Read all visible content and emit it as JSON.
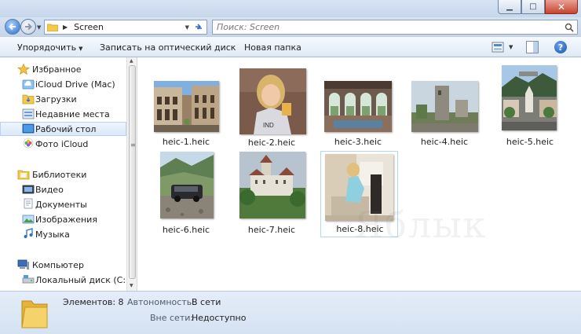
{
  "window": {
    "minimize_glyph": "▁",
    "maximize_glyph": "□",
    "close_glyph": "✕"
  },
  "address": {
    "path": "Screen",
    "search_placeholder": "Поиск: Screen"
  },
  "toolbar": {
    "organize_label": "Упорядочить",
    "burn_label": "Записать на оптический диск",
    "new_folder_label": "Новая папка",
    "help_label": "?"
  },
  "nav": {
    "favorites": {
      "label": "Избранное",
      "items": [
        {
          "label": "iCloud Drive (Mac)",
          "icon": "icloud-drive-icon"
        },
        {
          "label": "Загрузки",
          "icon": "downloads-folder-icon"
        },
        {
          "label": "Недавние места",
          "icon": "recent-places-icon"
        },
        {
          "label": "Рабочий стол",
          "icon": "desktop-icon"
        },
        {
          "label": "Фото iCloud",
          "icon": "icloud-photos-icon"
        }
      ]
    },
    "libraries": {
      "label": "Библиотеки",
      "items": [
        {
          "label": "Видео",
          "icon": "video-library-icon"
        },
        {
          "label": "Документы",
          "icon": "documents-library-icon"
        },
        {
          "label": "Изображения",
          "icon": "pictures-library-icon"
        },
        {
          "label": "Музыка",
          "icon": "music-library-icon"
        }
      ]
    },
    "computer": {
      "label": "Компьютер",
      "items": [
        {
          "label": "Локальный диск (C:)",
          "icon": "local-disk-icon"
        }
      ]
    }
  },
  "files": [
    {
      "name": "heic-1.heic",
      "selected": false
    },
    {
      "name": "heic-2.heic",
      "selected": false
    },
    {
      "name": "heic-3.heic",
      "selected": false
    },
    {
      "name": "heic-4.heic",
      "selected": false
    },
    {
      "name": "heic-5.heic",
      "selected": false
    },
    {
      "name": "heic-6.heic",
      "selected": false
    },
    {
      "name": "heic-7.heic",
      "selected": false
    },
    {
      "name": "heic-8.heic",
      "selected": true
    }
  ],
  "status": {
    "items_label": "Элементов: 8",
    "autonomy_key": "Автономность:",
    "autonomy_value": "В сети",
    "offline_key": "Вне сети:",
    "offline_value": "Недоступно"
  },
  "watermark": "Яблык",
  "colors": {
    "accent": "#2c6fcb",
    "selection": "#d9e8f9",
    "folder": "#f2c94c"
  }
}
